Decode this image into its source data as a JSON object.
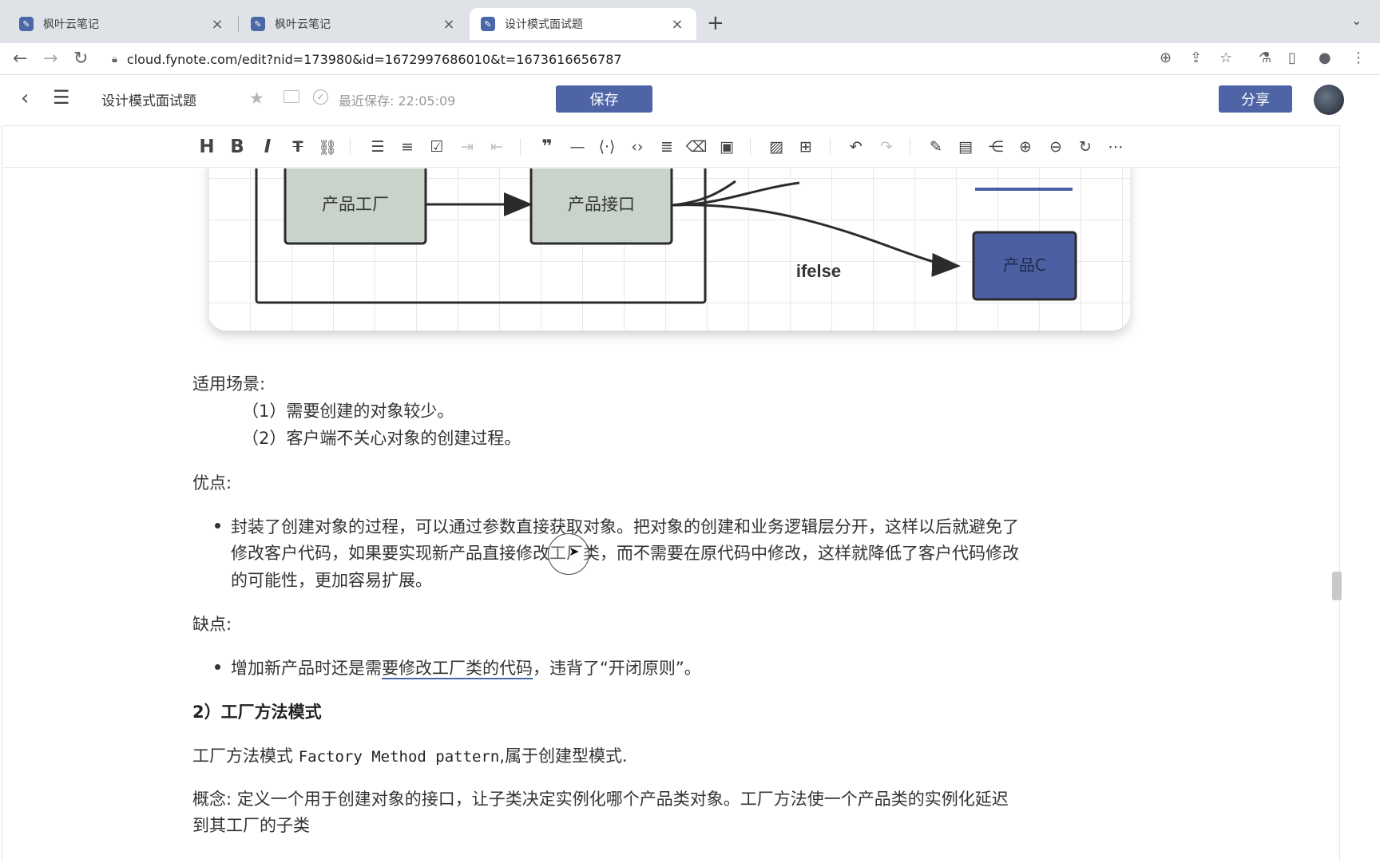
{
  "browser": {
    "tabs": [
      {
        "title": "枫叶云笔记",
        "active": false
      },
      {
        "title": "枫叶云笔记",
        "active": false
      },
      {
        "title": "设计模式面试题",
        "active": true
      }
    ],
    "new_tab": "+",
    "url": "cloud.fynote.com/edit?nid=173980&id=1672997686010&t=1673616656787"
  },
  "header": {
    "doc_title": "设计模式面试题",
    "last_save": "最近保存: 22:05:09",
    "save_label": "保存",
    "share_label": "分享"
  },
  "toolbar": {
    "buttons": [
      "heading",
      "bold",
      "italic",
      "strikethrough",
      "link",
      "bullet-list",
      "ordered-list",
      "task-list",
      "indent",
      "outdent",
      "quote",
      "horizontal-rule",
      "code-inline",
      "code-block",
      "align",
      "clear-format",
      "pdf-export",
      "image",
      "table",
      "undo",
      "redo",
      "draw",
      "ppt",
      "mindmap",
      "zoom-in",
      "zoom-out",
      "refresh",
      "more"
    ]
  },
  "diagram": {
    "nodes": {
      "factory": "产品工厂",
      "iface": "产品接口",
      "product_c": "产品C"
    },
    "edge_label": "ifelse",
    "colors": {
      "green_node": "#c9d3c9",
      "blue_node": "#4d5fa3",
      "outline": "#2b2b2b"
    }
  },
  "body": {
    "scenarios_title": "适用场景:",
    "scenario_1": "（1）需要创建的对象较少。",
    "scenario_2": "（2）客户端不关心对象的创建过程。",
    "pros_title": "优点:",
    "pros_line_1": "封装了创建对象的过程，可以通过参数直接获取对象。把对象的创建和业务逻辑层分开，这样以后就避免了",
    "pros_line_2": "修改客户代码，如果要实现新产品直接修改工厂类，而不需要在原代码中修改，这样就降低了客户代码修改",
    "pros_line_3": "的可能性，更加容易扩展。",
    "cons_title": "缺点:",
    "cons_pre": "增加新产品时还是需",
    "cons_underlined": "要修改工厂类的代码",
    "cons_post": "，违背了“开闭原则”。",
    "section_heading": "2）工厂方法模式",
    "fm_pre": "工厂方法模式 ",
    "fm_code": "Factory Method pattern",
    "fm_post": ",属于创建型模式.",
    "concept_line": "概念: 定义一个用于创建对象的接口，让子类决定实例化哪个产品类对象。工厂方法使一个产品类的实例化延迟",
    "concept_line_2": "到其工厂的子类"
  }
}
